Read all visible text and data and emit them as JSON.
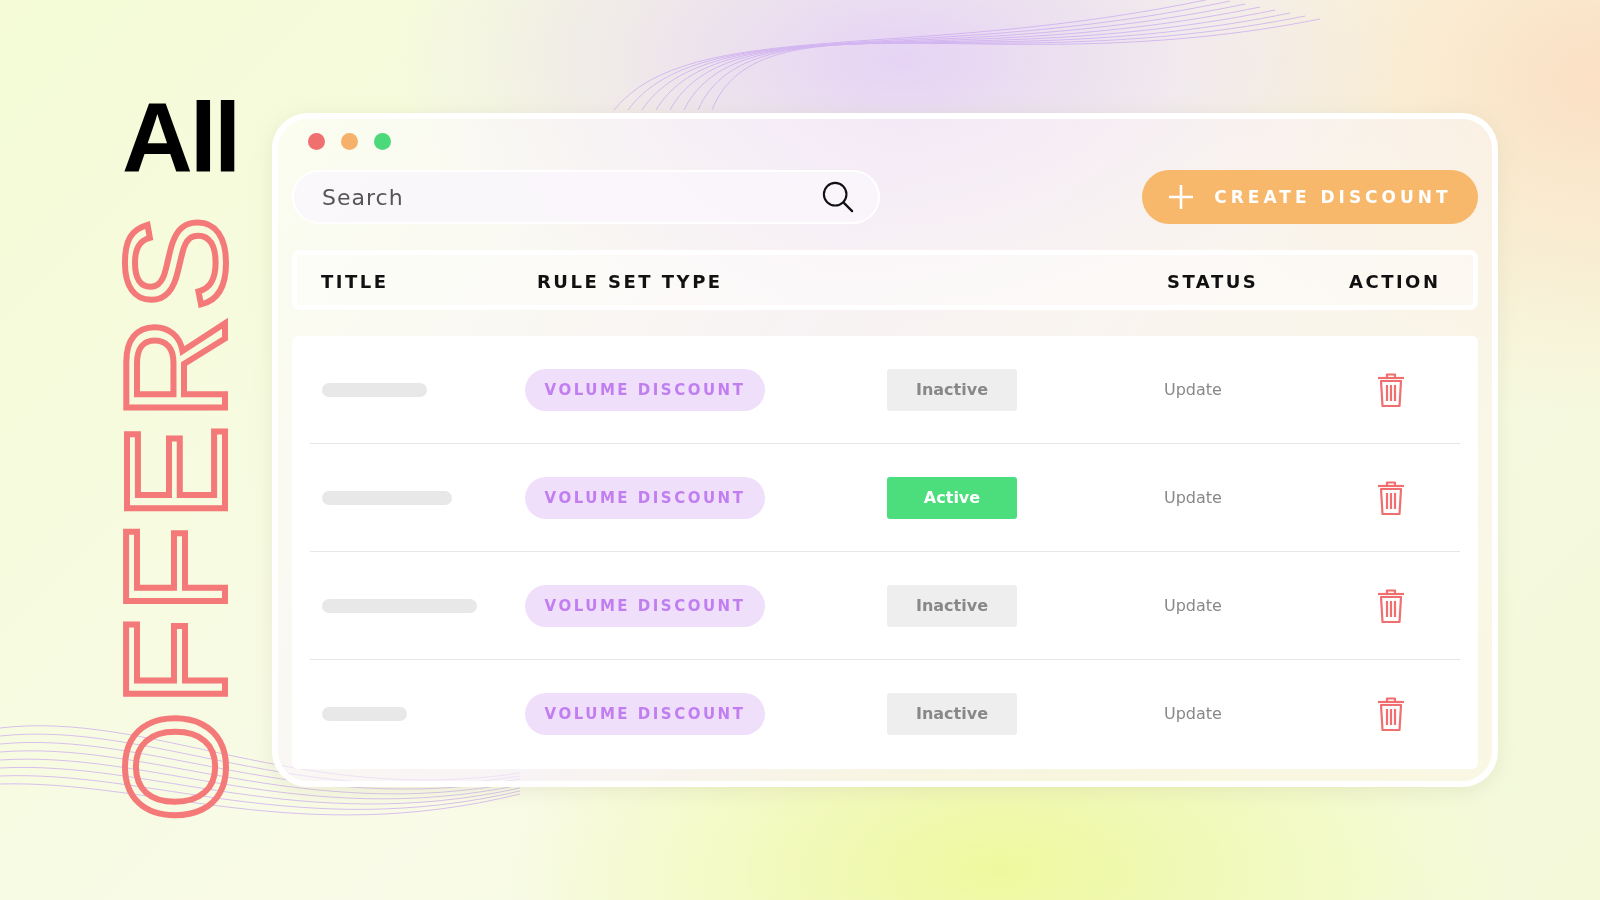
{
  "headline": {
    "line_1": "All",
    "line_2": "OFFERS"
  },
  "window": {
    "controls": [
      {
        "color": "#f07070"
      },
      {
        "color": "#f5b16a"
      },
      {
        "color": "#4cd97b"
      }
    ]
  },
  "search": {
    "placeholder": "Search"
  },
  "create_button": {
    "label": "CREATE DISCOUNT"
  },
  "table": {
    "columns": [
      "TITLE",
      "RULE SET TYPE",
      "STATUS",
      "ACTION"
    ],
    "rows": [
      {
        "rule_set_type": "VOLUME DISCOUNT",
        "status": "Inactive",
        "active": false,
        "action": "Update"
      },
      {
        "rule_set_type": "VOLUME DISCOUNT",
        "status": "Active",
        "active": true,
        "action": "Update"
      },
      {
        "rule_set_type": "VOLUME DISCOUNT",
        "status": "Inactive",
        "active": false,
        "action": "Update"
      },
      {
        "rule_set_type": "VOLUME DISCOUNT",
        "status": "Inactive",
        "active": false,
        "action": "Update"
      }
    ]
  }
}
